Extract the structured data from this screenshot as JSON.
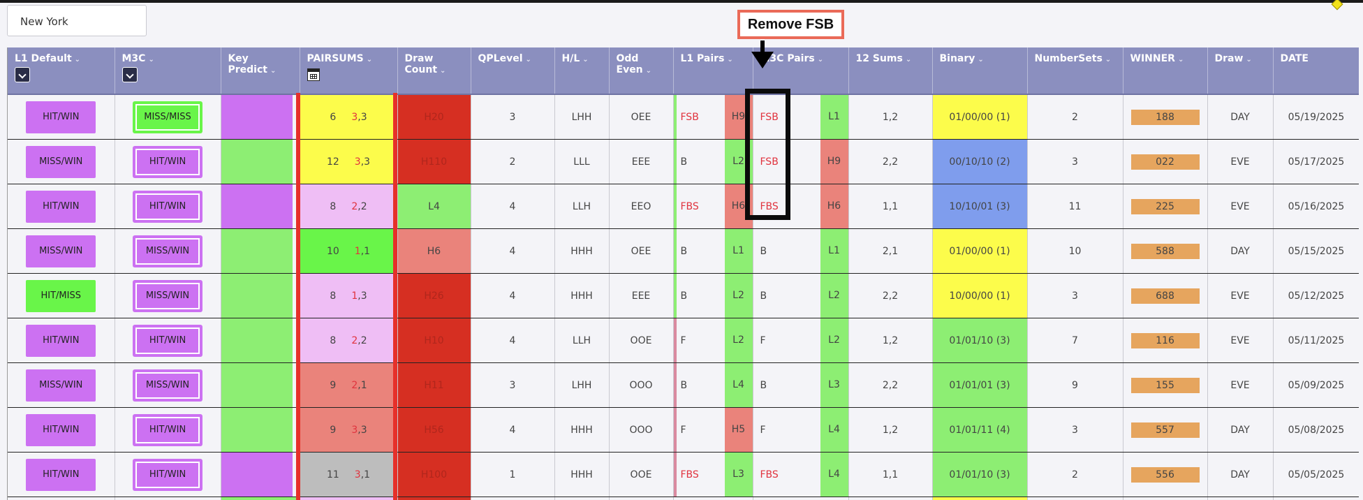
{
  "location": "New York",
  "annotation": "Remove FSB",
  "headers": [
    {
      "label": "L1 Default",
      "dropdown": true
    },
    {
      "label": "M3C",
      "dropdown": true
    },
    {
      "label": "Key Predict"
    },
    {
      "label": "PAIRSUMS",
      "calendar": true
    },
    {
      "label": "Draw Count"
    },
    {
      "label": "QPLevel"
    },
    {
      "label": "H/L"
    },
    {
      "label": "Odd Even"
    },
    {
      "label": "L1 Pairs"
    },
    {
      "label": "M3C Pairs"
    },
    {
      "label": "12 Sums"
    },
    {
      "label": "Binary"
    },
    {
      "label": "NumberSets"
    },
    {
      "label": "WINNER"
    },
    {
      "label": "Draw"
    },
    {
      "label": "DATE"
    }
  ],
  "rows": [
    {
      "l1": "HIT/WIN",
      "l1c": "purple",
      "m3c": "MISS/MISS",
      "m3cc": "bright-green",
      "kp": "purple",
      "ps": "6",
      "pa": "3",
      "pb": "3",
      "psc": "yellow",
      "dc": "H20",
      "dcc": "red",
      "qp": "3",
      "hl": "LHH",
      "oe": "OEE",
      "l1p": "FSB",
      "l1pred": true,
      "l1l": "H9",
      "l1lc": "salmon",
      "m3p": "FSB",
      "m3pred": true,
      "m3l": "L1",
      "m3lc": "l-green",
      "s12": "1,2",
      "bin": "01/00/00 (1)",
      "binc": "yellow",
      "ns": "2",
      "win": "188",
      "draw": "DAY",
      "date": "05/19/2025",
      "bar": "#8dee73"
    },
    {
      "l1": "MISS/WIN",
      "l1c": "purple",
      "m3c": "HIT/WIN",
      "m3cc": "purple",
      "kp": "green",
      "ps": "12",
      "pa": "3",
      "pb": "3",
      "psc": "yellow",
      "dc": "H110",
      "dcc": "red",
      "qp": "2",
      "hl": "LLL",
      "oe": "EEE",
      "l1p": "B",
      "l1pred": false,
      "l1l": "L2",
      "l1lc": "l-green",
      "m3p": "FSB",
      "m3pred": true,
      "m3l": "H9",
      "m3lc": "salmon",
      "s12": "2,2",
      "bin": "00/10/10 (2)",
      "binc": "blue",
      "ns": "3",
      "win": "022",
      "draw": "EVE",
      "date": "05/17/2025",
      "bar": "#8dee73"
    },
    {
      "l1": "HIT/WIN",
      "l1c": "purple",
      "m3c": "HIT/WIN",
      "m3cc": "purple",
      "kp": "purple",
      "ps": "8",
      "pa": "2",
      "pb": "2",
      "psc": "pink",
      "dc": "L4",
      "dcc": "green",
      "qp": "4",
      "hl": "LLH",
      "oe": "EEO",
      "l1p": "FBS",
      "l1pred": true,
      "l1l": "H6",
      "l1lc": "salmon",
      "m3p": "FBS",
      "m3pred": true,
      "m3l": "H6",
      "m3lc": "salmon",
      "s12": "1,1",
      "bin": "10/10/01 (3)",
      "binc": "blue",
      "ns": "11",
      "win": "225",
      "draw": "EVE",
      "date": "05/16/2025",
      "bar": "#8dee73"
    },
    {
      "l1": "MISS/WIN",
      "l1c": "purple",
      "m3c": "MISS/WIN",
      "m3cc": "purple",
      "kp": "green",
      "ps": "10",
      "pa": "1",
      "pb": "1",
      "psc": "bright-green",
      "dc": "H6",
      "dcc": "salmon",
      "qp": "4",
      "hl": "HHH",
      "oe": "OEE",
      "l1p": "B",
      "l1pred": false,
      "l1l": "L1",
      "l1lc": "l-green",
      "m3p": "B",
      "m3pred": false,
      "m3l": "L1",
      "m3lc": "l-green",
      "s12": "2,1",
      "bin": "01/00/00 (1)",
      "binc": "yellow",
      "ns": "10",
      "win": "588",
      "draw": "DAY",
      "date": "05/15/2025",
      "bar": "#8dee73"
    },
    {
      "l1": "HIT/MISS",
      "l1c": "green",
      "m3c": "MISS/WIN",
      "m3cc": "purple",
      "kp": "green",
      "ps": "8",
      "pa": "1",
      "pb": "3",
      "psc": "pink",
      "dc": "H26",
      "dcc": "red",
      "qp": "4",
      "hl": "HHH",
      "oe": "EEE",
      "l1p": "B",
      "l1pred": false,
      "l1l": "L2",
      "l1lc": "l-green",
      "m3p": "B",
      "m3pred": false,
      "m3l": "L2",
      "m3lc": "l-green",
      "s12": "2,2",
      "bin": "10/00/00 (1)",
      "binc": "yellow",
      "ns": "3",
      "win": "688",
      "draw": "EVE",
      "date": "05/12/2025",
      "bar": "#8dee73"
    },
    {
      "l1": "HIT/WIN",
      "l1c": "purple",
      "m3c": "HIT/WIN",
      "m3cc": "purple",
      "kp": "green",
      "ps": "8",
      "pa": "2",
      "pb": "2",
      "psc": "pink",
      "dc": "H10",
      "dcc": "red",
      "qp": "4",
      "hl": "LLH",
      "oe": "OOE",
      "l1p": "F",
      "l1pred": false,
      "l1l": "L2",
      "l1lc": "l-green",
      "m3p": "F",
      "m3pred": false,
      "m3l": "L2",
      "m3lc": "l-green",
      "s12": "1,2",
      "bin": "01/01/10 (3)",
      "binc": "green",
      "ns": "7",
      "win": "116",
      "draw": "EVE",
      "date": "05/11/2025",
      "bar": "#d98aa0"
    },
    {
      "l1": "MISS/WIN",
      "l1c": "purple",
      "m3c": "MISS/WIN",
      "m3cc": "purple",
      "kp": "green",
      "ps": "9",
      "pa": "2",
      "pb": "1",
      "psc": "salmon",
      "dc": "H11",
      "dcc": "red",
      "qp": "3",
      "hl": "LHH",
      "oe": "OOO",
      "l1p": "B",
      "l1pred": false,
      "l1l": "L4",
      "l1lc": "l-green",
      "m3p": "B",
      "m3pred": false,
      "m3l": "L3",
      "m3lc": "l-green",
      "s12": "2,2",
      "bin": "01/01/01 (3)",
      "binc": "green",
      "ns": "9",
      "win": "155",
      "draw": "EVE",
      "date": "05/09/2025",
      "bar": "#d98aa0"
    },
    {
      "l1": "HIT/WIN",
      "l1c": "purple",
      "m3c": "HIT/WIN",
      "m3cc": "purple",
      "kp": "green",
      "ps": "9",
      "pa": "3",
      "pb": "3",
      "psc": "salmon",
      "dc": "H56",
      "dcc": "red",
      "qp": "4",
      "hl": "HHH",
      "oe": "OOO",
      "l1p": "F",
      "l1pred": false,
      "l1l": "H5",
      "l1lc": "salmon",
      "m3p": "F",
      "m3pred": false,
      "m3l": "L4",
      "m3lc": "l-green",
      "s12": "1,2",
      "bin": "01/01/11 (4)",
      "binc": "green",
      "ns": "3",
      "win": "557",
      "draw": "DAY",
      "date": "05/08/2025",
      "bar": "#d98aa0"
    },
    {
      "l1": "HIT/WIN",
      "l1c": "purple",
      "m3c": "HIT/WIN",
      "m3cc": "purple",
      "kp": "purple",
      "ps": "11",
      "pa": "3",
      "pb": "1",
      "psc": "grey",
      "dc": "H100",
      "dcc": "red",
      "qp": "1",
      "hl": "HHH",
      "oe": "OOE",
      "l1p": "FBS",
      "l1pred": true,
      "l1l": "L3",
      "l1lc": "l-green",
      "m3p": "FBS",
      "m3pred": true,
      "m3l": "L4",
      "m3lc": "l-green",
      "s12": "1,1",
      "bin": "01/01/10 (3)",
      "binc": "green",
      "ns": "2",
      "win": "556",
      "draw": "DAY",
      "date": "05/05/2025",
      "bar": "#d98aa0"
    }
  ]
}
